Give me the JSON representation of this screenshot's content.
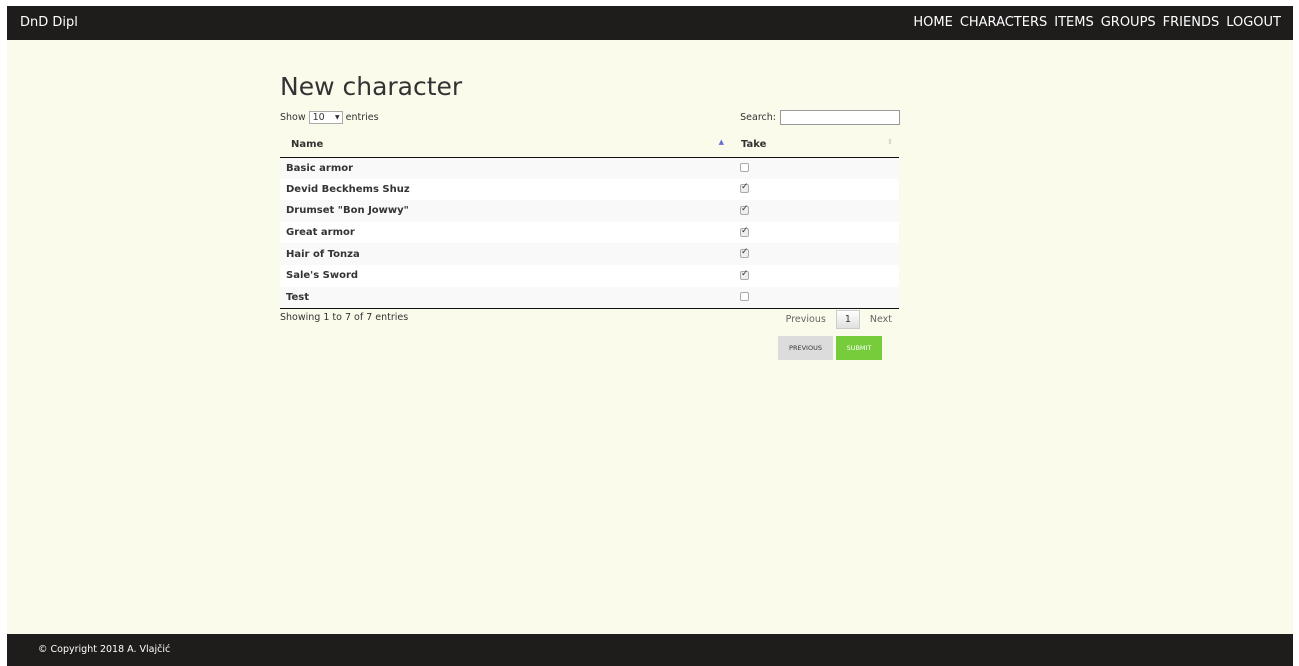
{
  "navbar": {
    "brand": "DnD Dipl",
    "links": [
      "HOME",
      "CHARACTERS",
      "ITEMS",
      "GROUPS",
      "FRIENDS",
      "LOGOUT"
    ]
  },
  "main": {
    "title": "New character",
    "show_prefix": "Show",
    "show_value": "10",
    "show_suffix": "entries",
    "search_label": "Search:",
    "search_value": "",
    "columns": [
      "Name",
      "Take"
    ],
    "rows": [
      {
        "name": "Basic armor",
        "take": false
      },
      {
        "name": "Devid Beckhems Shuz",
        "take": true
      },
      {
        "name": "Drumset \"Bon Jowwy\"",
        "take": true
      },
      {
        "name": "Great armor",
        "take": true
      },
      {
        "name": "Hair of Tonza",
        "take": true
      },
      {
        "name": "Sale's Sword",
        "take": true
      },
      {
        "name": "Test",
        "take": false
      }
    ],
    "info": "Showing 1 to 7 of 7 entries",
    "pagination": {
      "previous": "Previous",
      "page": "1",
      "next": "Next"
    },
    "buttons": {
      "previous": "PREVIOUS",
      "submit": "SUBMIT"
    }
  },
  "footer": {
    "text": "© Copyright 2018 A. Vlajčić"
  },
  "colors": {
    "navbar": "#1f1d1c",
    "background": "#fafbeb",
    "submit": "#76cc3b",
    "sort_active": "#6b6fd1"
  }
}
